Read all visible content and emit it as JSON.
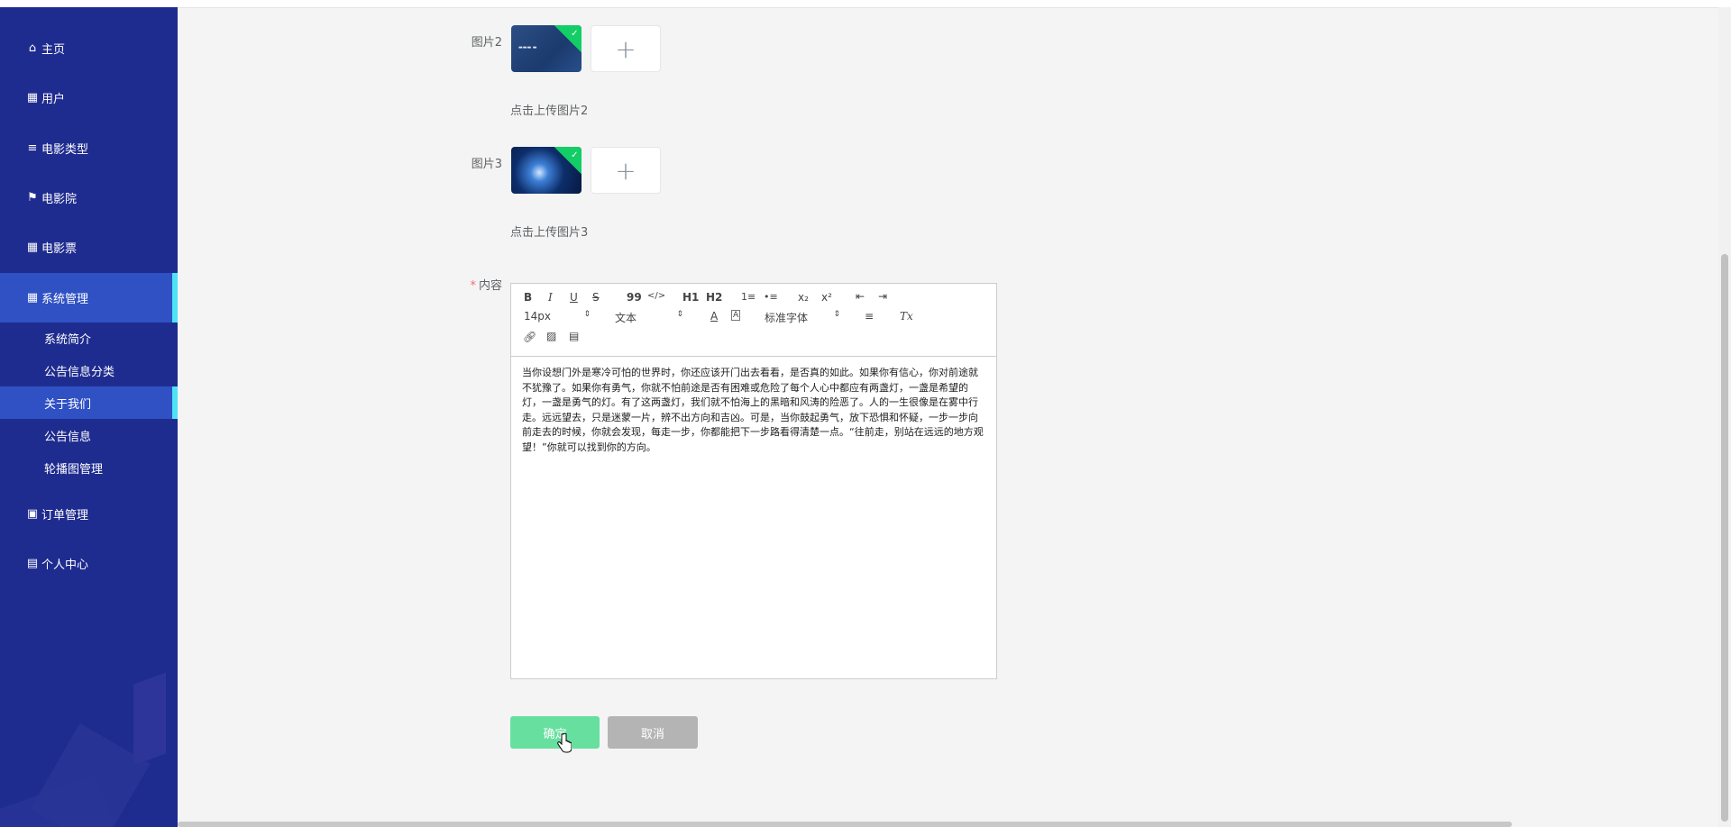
{
  "sidebar": {
    "items": [
      {
        "label": "主页",
        "icon": "home-icon"
      },
      {
        "label": "用户",
        "icon": "grid-icon"
      },
      {
        "label": "电影类型",
        "icon": "list-icon"
      },
      {
        "label": "电影院",
        "icon": "flag-icon"
      },
      {
        "label": "电影票",
        "icon": "grid-icon"
      },
      {
        "label": "系统管理",
        "icon": "grid-icon"
      },
      {
        "label": "订单管理",
        "icon": "briefcase-icon"
      },
      {
        "label": "个人中心",
        "icon": "card-icon"
      }
    ],
    "sub_items": [
      {
        "label": "系统简介"
      },
      {
        "label": "公告信息分类"
      },
      {
        "label": "关于我们"
      },
      {
        "label": "公告信息"
      },
      {
        "label": "轮播图管理"
      }
    ]
  },
  "form": {
    "pic2_label": "图片2",
    "pic2_hint": "点击上传图片2",
    "pic3_label": "图片3",
    "pic3_hint": "点击上传图片3",
    "content_label": "内容",
    "required_mark": "*",
    "upload_plus": "+"
  },
  "editor": {
    "toolbar": {
      "bold": "B",
      "italic": "I",
      "underline": "U",
      "strike": "S",
      "blockquote": "99",
      "code": "</>",
      "h1": "H1",
      "h2": "H2",
      "ordered_list": "1≡",
      "bullet_list": "•≡",
      "subscript": "x₂",
      "superscript": "x²",
      "outdent": "⇤",
      "indent": "⇥",
      "size": "14px",
      "header": "文本",
      "font": "标准字体",
      "text_color": "A",
      "bg_color": "A",
      "align": "≡",
      "clean": "Tx"
    },
    "content": "当你设想门外是寒冷可怕的世界时，你还应该开门出去看看，是否真的如此。如果你有信心，你对前途就不犹豫了。如果你有勇气，你就不怕前途是否有困难或危险了每个人心中都应有两盏灯，一盏是希望的灯，一盏是勇气的灯。有了这两盏灯，我们就不怕海上的黑暗和风涛的险恶了。人的一生很像是在雾中行走。远远望去，只是迷蒙一片，辨不出方向和吉凶。可是，当你鼓起勇气，放下恐惧和怀疑，一步一步向前走去的时候，你就会发现，每走一步，你都能把下一步路看得清楚一点。“往前走，别站在远远的地方观望！”你就可以找到你的方向。"
  },
  "buttons": {
    "confirm": "确定",
    "cancel": "取消"
  },
  "colors": {
    "sidebar_bg": "#1f2c8f",
    "active_bg": "#2f51c4",
    "active_accent": "#4de3f5",
    "confirm": "#67e09f",
    "cancel": "#b4b4b4"
  }
}
